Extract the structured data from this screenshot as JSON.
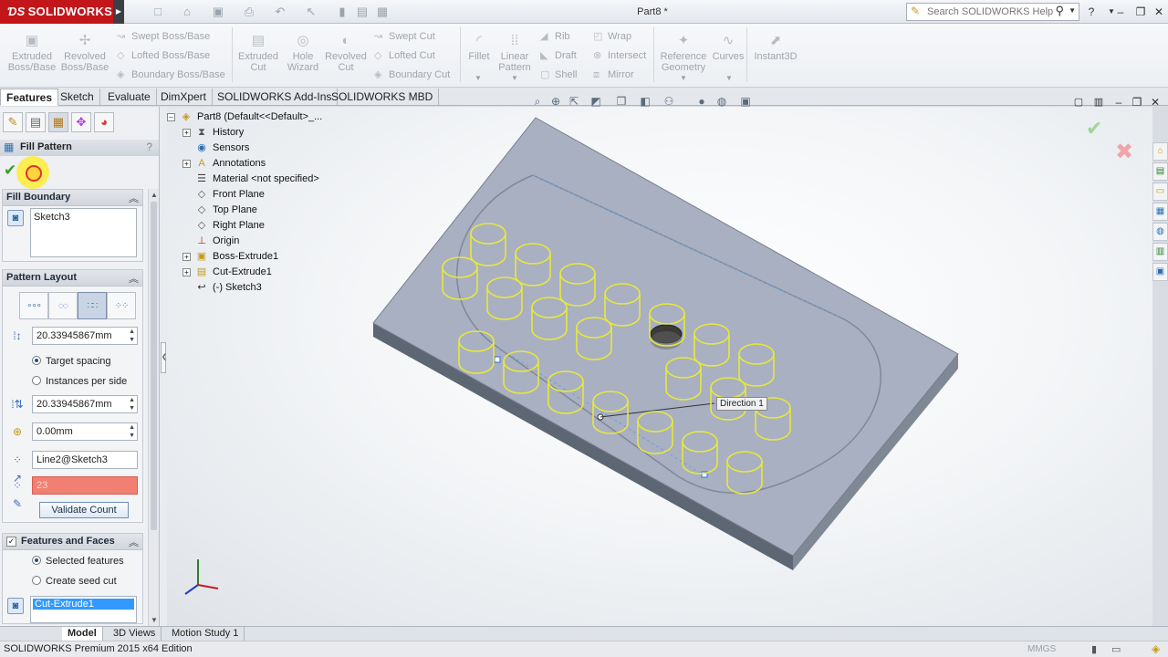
{
  "titlebar": {
    "app_name": "SOLIDWORKS",
    "doc_title": "Part8 *",
    "search_placeholder": "Search SOLIDWORKS Help"
  },
  "command_manager": {
    "extruded_boss": "Extruded Boss/Base",
    "revolved_boss": "Revolved Boss/Base",
    "swept_boss": "Swept Boss/Base",
    "lofted_boss": "Lofted Boss/Base",
    "boundary_boss": "Boundary Boss/Base",
    "extruded_cut": "Extruded Cut",
    "hole_wizard": "Hole Wizard",
    "revolved_cut": "Revolved Cut",
    "swept_cut": "Swept Cut",
    "lofted_cut": "Lofted Cut",
    "boundary_cut": "Boundary Cut",
    "fillet": "Fillet",
    "linear_pattern": "Linear Pattern",
    "rib": "Rib",
    "draft": "Draft",
    "shell": "Shell",
    "wrap": "Wrap",
    "intersect": "Intersect",
    "mirror": "Mirror",
    "reference_geometry": "Reference Geometry",
    "curves": "Curves",
    "instant3d": "Instant3D"
  },
  "tabs": [
    "Features",
    "Sketch",
    "Evaluate",
    "DimXpert",
    "SOLIDWORKS Add-Ins",
    "SOLIDWORKS MBD"
  ],
  "property_manager": {
    "title": "Fill Pattern",
    "help": "?",
    "fill_boundary": {
      "header": "Fill Boundary",
      "selection": "Sketch3"
    },
    "pattern_layout": {
      "header": "Pattern Layout",
      "spacing_value": "20.33945867mm",
      "target_spacing": "Target spacing",
      "instances_per_side": "Instances per side",
      "stagger_value": "20.33945867mm",
      "margin_value": "0.00mm",
      "direction_ref": "Line2@Sketch3",
      "instance_count": "23",
      "validate_label": "Validate Count"
    },
    "features_faces": {
      "header": "Features and Faces",
      "selected_features": "Selected features",
      "create_seed_cut": "Create seed cut",
      "selection": "Cut-Extrude1"
    }
  },
  "feature_tree": {
    "root": "Part8  (Default<<Default>_...",
    "items": [
      {
        "label": "History",
        "icon": "history-icon",
        "expandable": true
      },
      {
        "label": "Sensors",
        "icon": "sensors-icon",
        "expandable": false
      },
      {
        "label": "Annotations",
        "icon": "annotations-icon",
        "expandable": true
      },
      {
        "label": "Material <not specified>",
        "icon": "material-icon",
        "expandable": false
      },
      {
        "label": "Front Plane",
        "icon": "plane-icon",
        "expandable": false
      },
      {
        "label": "Top Plane",
        "icon": "plane-icon",
        "expandable": false
      },
      {
        "label": "Right Plane",
        "icon": "plane-icon",
        "expandable": false
      },
      {
        "label": "Origin",
        "icon": "origin-icon",
        "expandable": false
      },
      {
        "label": "Boss-Extrude1",
        "icon": "boss-extrude-icon",
        "expandable": true
      },
      {
        "label": "Cut-Extrude1",
        "icon": "cut-extrude-icon",
        "expandable": true
      },
      {
        "label": "(-) Sketch3",
        "icon": "sketch-icon",
        "expandable": false
      }
    ]
  },
  "viewport": {
    "direction_label": "Direction 1",
    "pattern_color": "#e8e83a"
  },
  "bottom_tabs": [
    "Model",
    "3D Views",
    "Motion Study 1"
  ],
  "statusbar": {
    "text": "SOLIDWORKS Premium 2015 x64 Edition",
    "units": "MMGS"
  }
}
